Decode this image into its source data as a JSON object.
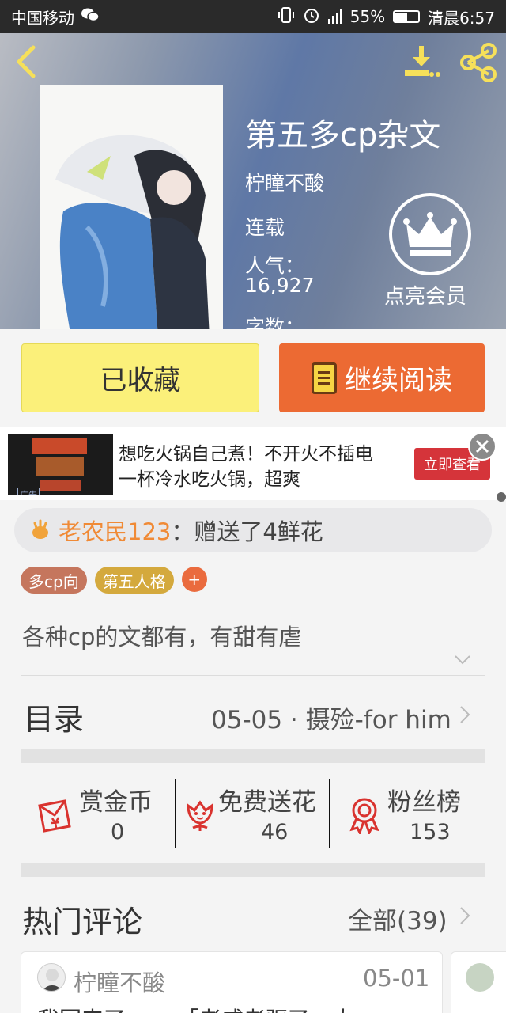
{
  "status_bar": {
    "carrier": "中国移动",
    "battery": "55%",
    "battery_level": 0.55,
    "time": "清晨6:57"
  },
  "book": {
    "title": "第五多cp杂文",
    "author": "柠瞳不酸",
    "status": "连载",
    "popularity_label": "人气：",
    "popularity_value": "16,927",
    "words_label": "字数："
  },
  "vip": {
    "label": "点亮会员"
  },
  "actions": {
    "collected_label": "已收藏",
    "continue_label": "继续阅读"
  },
  "ad": {
    "line1": "想吃火锅自己煮！不开火不插电",
    "line2": "一杯冷水吃火锅，超爽",
    "button": "立即查看",
    "tag": "广告"
  },
  "gift_banner": {
    "user": "老农民123",
    "message": "：赠送了4鲜花"
  },
  "tags": [
    "多cp向",
    "第五人格"
  ],
  "tag_add": "+",
  "description": "各种cp的文都有，有甜有虐",
  "toc": {
    "label": "目录",
    "latest": "05-05 · 摄殓-for him"
  },
  "stats": [
    {
      "label": "赏金币",
      "value": "0"
    },
    {
      "label": "免费送花",
      "value": "46"
    },
    {
      "label": "粉丝榜",
      "value": "153"
    }
  ],
  "comments": {
    "label": "热门评论",
    "all": "全部(39)",
    "first": {
      "author": "柠瞳不酸",
      "date": "05-01",
      "text": "我回来了～ ～「老咸老驱了一大"
    }
  },
  "colors": {
    "accent_orange": "#ec6a33",
    "collect_yellow": "#fbf07a",
    "gift_user": "#f08a36"
  }
}
